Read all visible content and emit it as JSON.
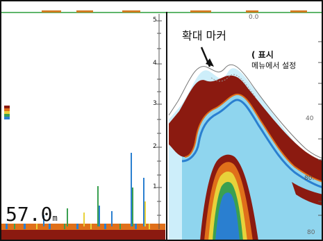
{
  "colors": {
    "frame_border": "#111111",
    "top_line": "#2a9d3a",
    "echo_red": "#8b1a10",
    "echo_orange": "#e0701a",
    "echo_yellow": "#e8d23a",
    "echo_green": "#3aa050",
    "echo_blue": "#2a7fd0",
    "echo_light_blue": "#7fd0ee",
    "echo_pale": "#cdeefa"
  },
  "history_panel": {
    "scale_labels": [
      "5",
      "4",
      "3",
      "2",
      "1"
    ],
    "depth_readout": {
      "value": "57.0",
      "unit": "m"
    }
  },
  "zoom_panel": {
    "scale_labels": [
      "0.0",
      "40",
      "80.",
      "80"
    ],
    "callout": {
      "title": "확대 마커",
      "note_open": "( ",
      "note_bold": "표시",
      "note_line2": "메뉴에서 설정"
    }
  },
  "icons": {
    "callout_arrow": "arrow-down-right-icon",
    "color_bar": "color-scale-icon"
  }
}
